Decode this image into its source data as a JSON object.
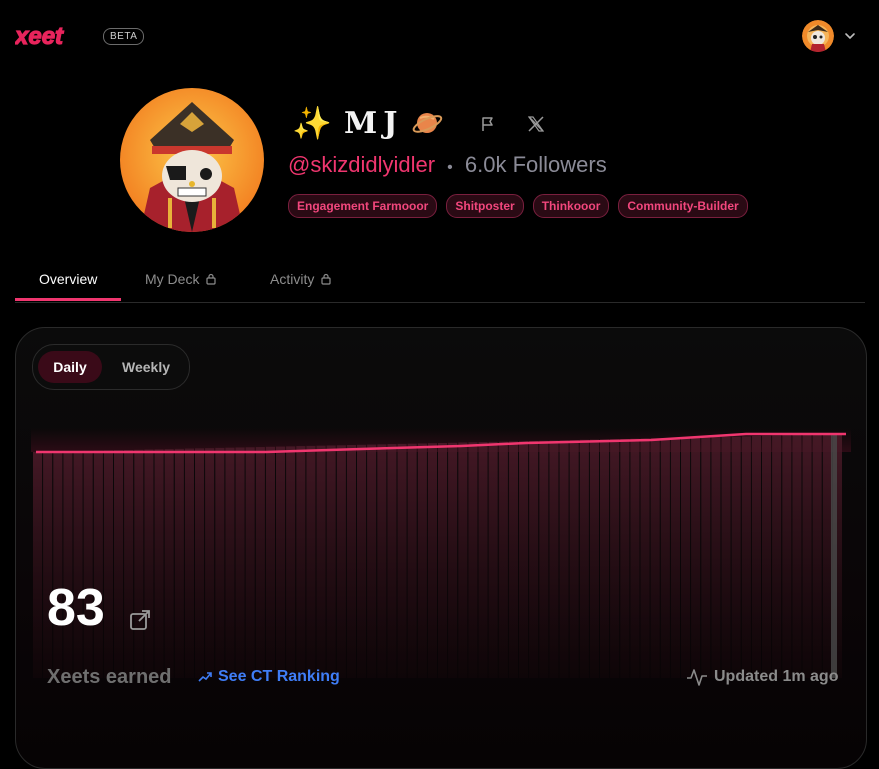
{
  "header": {
    "logo_text": "xeet",
    "beta_label": "BETA",
    "brand_color": "#e8245c",
    "avatar_icon": "user-avatar",
    "menu_icon": "chevron-down-icon"
  },
  "profile": {
    "name_prefix_emoji": "✨",
    "name": "MJ",
    "name_suffix_icon": "planet-icon",
    "handle": "@skizdidlyidler",
    "separator": "•",
    "followers": "6.0k Followers",
    "tags": [
      "Engagement Farmooor",
      "Shitposter",
      "Thinkooor",
      "Community-Builder"
    ],
    "flag_icon": "flag-icon",
    "x_icon": "x-logo-icon"
  },
  "tabs": [
    {
      "label": "Overview",
      "locked": false,
      "active": true
    },
    {
      "label": "My Deck",
      "locked": true,
      "active": false
    },
    {
      "label": "Activity",
      "locked": true,
      "active": false
    }
  ],
  "card": {
    "toggle": {
      "daily": "Daily",
      "weekly": "Weekly",
      "selected": "Daily"
    },
    "value": "83",
    "value_label": "Xeets earned",
    "ranking_link": "See CT Ranking",
    "updated": "Updated 1m ago",
    "accent_color": "#f0366f"
  }
}
